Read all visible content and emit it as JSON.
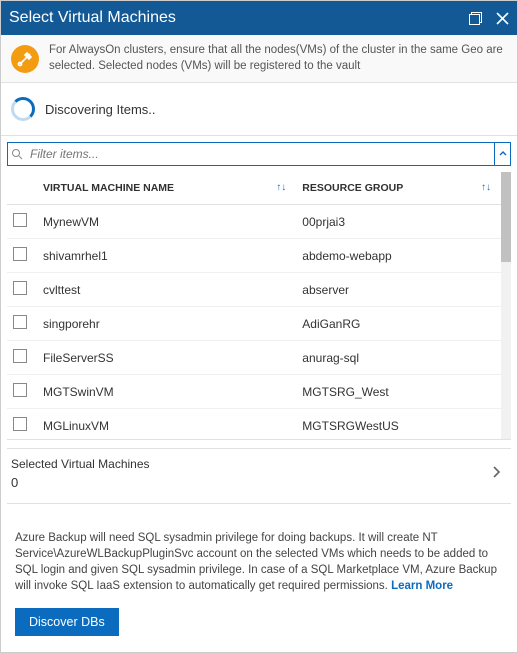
{
  "titlebar": {
    "title": "Select Virtual Machines"
  },
  "info_banner": {
    "text": "For AlwaysOn clusters, ensure that all the nodes(VMs) of the cluster in the same Geo are selected. Selected nodes (VMs) will be registered to the vault"
  },
  "discovery": {
    "text": "Discovering Items.."
  },
  "search": {
    "placeholder": "Filter items..."
  },
  "table": {
    "columns": {
      "vm_name": "VIRTUAL MACHINE NAME",
      "resource_group": "RESOURCE GROUP"
    },
    "rows": [
      {
        "vm": "MynewVM",
        "rg": "00prjai3"
      },
      {
        "vm": "shivamrhel1",
        "rg": "abdemo-webapp"
      },
      {
        "vm": "cvlttest",
        "rg": "abserver"
      },
      {
        "vm": "singporehr",
        "rg": "AdiGanRG"
      },
      {
        "vm": "FileServerSS",
        "rg": "anurag-sql"
      },
      {
        "vm": "MGTSwinVM",
        "rg": "MGTSRG_West"
      },
      {
        "vm": "MGLinuxVM",
        "rg": "MGTSRGWestUS"
      }
    ]
  },
  "selected": {
    "label": "Selected Virtual Machines",
    "count": "0"
  },
  "footer": {
    "text": "Azure Backup will need SQL sysadmin privilege for doing backups. It will create NT Service\\AzureWLBackupPluginSvc account on the selected VMs which needs to be added to SQL login and given SQL sysadmin privilege. In case of a SQL Marketplace VM, Azure Backup will invoke SQL IaaS extension to automatically get required permissions. ",
    "learn_more": "Learn More",
    "button": "Discover DBs"
  }
}
